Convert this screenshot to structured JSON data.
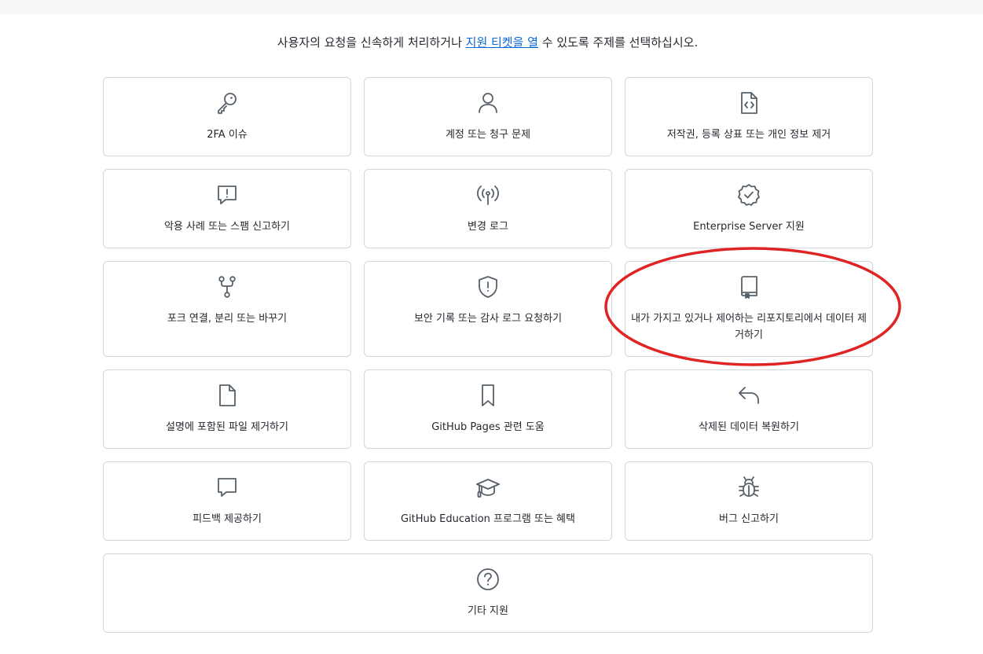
{
  "intro": {
    "before": "사용자의 요청을 신속하게 처리하거나 ",
    "link": "지원 티켓을 열",
    "after": " 수 있도록 주제를 선택하십시오."
  },
  "cards": [
    {
      "label": "2FA 이슈",
      "icon": "key-icon"
    },
    {
      "label": "계정 또는 청구 문제",
      "icon": "person-icon"
    },
    {
      "label": "저작권, 등록 상표 또는 개인 정보 제거",
      "icon": "file-code-icon"
    },
    {
      "label": "악용 사례 또는 스팸 신고하기",
      "icon": "report-icon"
    },
    {
      "label": "변경 로그",
      "icon": "broadcast-icon"
    },
    {
      "label": "Enterprise Server 지원",
      "icon": "verified-icon"
    },
    {
      "label": "포크 연결, 분리 또는 바꾸기",
      "icon": "repo-forked-icon"
    },
    {
      "label": "보안 기록 또는 감사 로그 요청하기",
      "icon": "shield-icon"
    },
    {
      "label": "내가 가지고 있거나 제어하는 리포지토리에서 데이터 제거하기",
      "icon": "repo-icon"
    },
    {
      "label": "설명에 포함된 파일 제거하기",
      "icon": "file-icon"
    },
    {
      "label": "GitHub Pages 관련 도움",
      "icon": "bookmark-icon"
    },
    {
      "label": "삭제된 데이터 복원하기",
      "icon": "reply-icon"
    },
    {
      "label": "피드백 제공하기",
      "icon": "comment-icon"
    },
    {
      "label": "GitHub Education 프로그램 또는 혜택",
      "icon": "mortar-board-icon"
    },
    {
      "label": "버그 신고하기",
      "icon": "bug-icon"
    },
    {
      "label": "기타 지원",
      "icon": "question-icon"
    }
  ],
  "colors": {
    "text": "#24292f",
    "link": "#0969da",
    "border": "#d0d7de",
    "highlight": "#e02424"
  }
}
